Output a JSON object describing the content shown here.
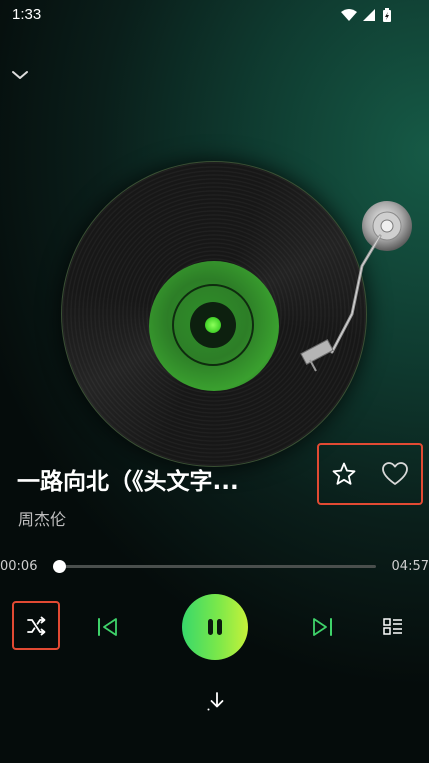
{
  "status_bar": {
    "time": "1:33",
    "icons": [
      "wifi-icon",
      "cell-signal-icon",
      "battery-charging-icon"
    ]
  },
  "header": {
    "collapse_icon": "chevron-down-icon"
  },
  "song": {
    "title": "一路向北（《头文字...",
    "artist": "周杰伦"
  },
  "actions": {
    "favorite_icon": "star-icon",
    "like_icon": "heart-icon"
  },
  "progress": {
    "current_time": "00:06",
    "total_time": "04:57",
    "fraction": 0.02
  },
  "controls": {
    "shuffle_icon": "shuffle-icon",
    "previous_icon": "previous-icon",
    "play_state_icon": "pause-icon",
    "next_icon": "next-icon",
    "playlist_icon": "playlist-icon",
    "download_icon": "download-icon"
  },
  "colors": {
    "accent_green": "#4ad82e",
    "highlight_box": "#e24a33",
    "play_gradient_start": "#38d86a",
    "play_gradient_end": "#c6f23a"
  }
}
